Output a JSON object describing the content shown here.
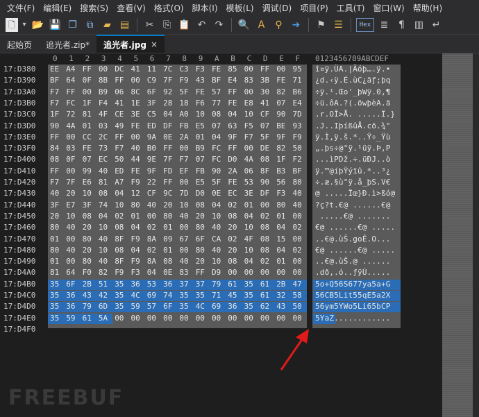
{
  "menu": [
    "文件(F)",
    "编辑(E)",
    "搜索(S)",
    "查看(V)",
    "格式(O)",
    "脚本(I)",
    "模板(L)",
    "调试(D)",
    "项目(P)",
    "工具(T)",
    "窗口(W)",
    "帮助(H)"
  ],
  "toolbar": {
    "hex_label": "Hex",
    "icons": [
      "new-file-icon",
      "dropdown-icon",
      "open-folder-icon",
      "save-icon",
      "save-all-icon",
      "copy-file-icon",
      "folder-icon",
      "folder-multi-icon",
      "cut-icon",
      "copy-icon",
      "paste-icon",
      "undo-icon",
      "redo-icon",
      "find-icon",
      "replace-icon",
      "find-replace-icon",
      "goto-arrow-icon",
      "bookmark-icon",
      "bookmark-list-icon",
      "hex-toggle-icon",
      "format-icon",
      "pilcrow-icon",
      "columns-icon",
      "wrap-icon"
    ]
  },
  "tabs": [
    {
      "label": "起始页",
      "active": false,
      "close": ""
    },
    {
      "label": "追光者.zip*",
      "active": false,
      "close": ""
    },
    {
      "label": "追光者.jpg",
      "active": true,
      "close": "×"
    }
  ],
  "hex_ruler": [
    "0",
    "1",
    "2",
    "3",
    "4",
    "5",
    "6",
    "7",
    "8",
    "9",
    "A",
    "B",
    "C",
    "D",
    "E",
    "F"
  ],
  "ascii_ruler": "0123456789ABCDEF",
  "rows": [
    {
      "addr": "17:D380",
      "bytes": [
        "EE",
        "A4",
        "FF",
        "00",
        "DC",
        "41",
        "11",
        "7C",
        "C3",
        "F3",
        "FE",
        "85",
        "00",
        "FF",
        "00",
        "95"
      ],
      "ascii": "î¤ÿ.ÜA.|Ãóþ….ÿ.•",
      "sel": 0
    },
    {
      "addr": "17:D390",
      "bytes": [
        "BF",
        "64",
        "0F",
        "8B",
        "FF",
        "00",
        "C9",
        "7F",
        "F9",
        "43",
        "BF",
        "E4",
        "83",
        "3B",
        "FE",
        "71"
      ],
      "ascii": "¿d.‹ÿ.É.ùC¿äƒ;þq",
      "sel": 0
    },
    {
      "addr": "17:D3A0",
      "bytes": [
        "F7",
        "FF",
        "00",
        "B9",
        "06",
        "8C",
        "6F",
        "92",
        "5F",
        "FE",
        "57",
        "FF",
        "00",
        "30",
        "82",
        "B6"
      ],
      "ascii": "÷ÿ.¹.Œo'_þWÿ.0‚¶",
      "sel": 0
    },
    {
      "addr": "17:D3B0",
      "bytes": [
        "F7",
        "FC",
        "1F",
        "F4",
        "41",
        "1E",
        "3F",
        "28",
        "18",
        "F6",
        "77",
        "FE",
        "E8",
        "41",
        "07",
        "E4"
      ],
      "ascii": "÷ü.ôA.?(.öwþèA.ä",
      "sel": 0
    },
    {
      "addr": "17:D3C0",
      "bytes": [
        "1F",
        "72",
        "81",
        "4F",
        "CE",
        "3E",
        "C5",
        "04",
        "A0",
        "10",
        "08",
        "04",
        "10",
        "CF",
        "90",
        "7D"
      ],
      "ascii": ".r.OÎ>Å. .....Ï.}",
      "sel": 0
    },
    {
      "addr": "17:D3D0",
      "bytes": [
        "90",
        "4A",
        "01",
        "03",
        "49",
        "FE",
        "ED",
        "DF",
        "FB",
        "E5",
        "07",
        "63",
        "F5",
        "07",
        "BE",
        "93"
      ],
      "ascii": ".J..IþíßûÅ.cõ.¾\"",
      "sel": 0
    },
    {
      "addr": "17:D3E0",
      "bytes": [
        "FF",
        "00",
        "CC",
        "2C",
        "FF",
        "00",
        "9A",
        "0E",
        "2A",
        "01",
        "04",
        "9F",
        "F7",
        "5F",
        "9F",
        "F9"
      ],
      "ascii": "ÿ.Ì,ÿ.š.*..Ÿ÷_Ÿù",
      "sel": 0
    },
    {
      "addr": "17:D3F0",
      "bytes": [
        "84",
        "03",
        "FE",
        "73",
        "F7",
        "40",
        "B0",
        "FF",
        "00",
        "B9",
        "FC",
        "FF",
        "00",
        "DE",
        "82",
        "50"
      ],
      "ascii": "„.þs÷@°ÿ.¹üÿ.Þ‚P",
      "sel": 0
    },
    {
      "addr": "17:D400",
      "bytes": [
        "08",
        "0F",
        "07",
        "EC",
        "50",
        "44",
        "9E",
        "7F",
        "F7",
        "07",
        "FC",
        "D0",
        "4A",
        "08",
        "1F",
        "F2"
      ],
      "ascii": "...ìPDž.÷.üÐJ..ò",
      "sel": 0
    },
    {
      "addr": "17:D410",
      "bytes": [
        "FF",
        "00",
        "99",
        "40",
        "ED",
        "FE",
        "9F",
        "FD",
        "EF",
        "FB",
        "90",
        "2A",
        "06",
        "8F",
        "B3",
        "BF"
      ],
      "ascii": "ÿ.™@íþŸýïû.*..³¿",
      "sel": 0
    },
    {
      "addr": "17:D420",
      "bytes": [
        "F7",
        "7F",
        "E6",
        "81",
        "A7",
        "F9",
        "22",
        "FF",
        "00",
        "E5",
        "5F",
        "FE",
        "53",
        "90",
        "56",
        "80"
      ],
      "ascii": "÷.æ.§ù\"ÿ.å_þS.V€",
      "sel": 0
    },
    {
      "addr": "17:D430",
      "bytes": [
        "40",
        "20",
        "10",
        "08",
        "04",
        "12",
        "CF",
        "9C",
        "7D",
        "D0",
        "0E",
        "EC",
        "3E",
        "DF",
        "F3",
        "40"
      ],
      "ascii": "@ .....Ïœ}Ð.ì>ßó@",
      "sel": 0
    },
    {
      "addr": "17:D440",
      "bytes": [
        "3F",
        "E7",
        "3F",
        "74",
        "10",
        "80",
        "40",
        "20",
        "10",
        "08",
        "04",
        "02",
        "01",
        "00",
        "80",
        "40"
      ],
      "ascii": "?ç?t.€@ ......€@",
      "sel": 0
    },
    {
      "addr": "17:D450",
      "bytes": [
        "20",
        "10",
        "08",
        "04",
        "02",
        "01",
        "00",
        "80",
        "40",
        "20",
        "10",
        "08",
        "04",
        "02",
        "01",
        "00"
      ],
      "ascii": " .....€@ .......",
      "sel": 0
    },
    {
      "addr": "17:D460",
      "bytes": [
        "80",
        "40",
        "20",
        "10",
        "08",
        "04",
        "02",
        "01",
        "00",
        "80",
        "40",
        "20",
        "10",
        "08",
        "04",
        "02"
      ],
      "ascii": "€@ ......€@ .....",
      "sel": 0
    },
    {
      "addr": "17:D470",
      "bytes": [
        "01",
        "00",
        "80",
        "40",
        "8F",
        "F9",
        "8A",
        "09",
        "67",
        "6F",
        "CA",
        "02",
        "4F",
        "08",
        "15",
        "00"
      ],
      "ascii": "..€@.ùŠ.goÊ.O...",
      "sel": 0
    },
    {
      "addr": "17:D480",
      "bytes": [
        "80",
        "40",
        "20",
        "10",
        "08",
        "04",
        "02",
        "01",
        "00",
        "80",
        "40",
        "20",
        "10",
        "08",
        "04",
        "02"
      ],
      "ascii": "€@ ......€@ .....",
      "sel": 0
    },
    {
      "addr": "17:D490",
      "bytes": [
        "01",
        "00",
        "80",
        "40",
        "8F",
        "F9",
        "8A",
        "08",
        "40",
        "20",
        "10",
        "08",
        "04",
        "02",
        "01",
        "00"
      ],
      "ascii": "..€@.ùŠ.@ ......",
      "sel": 0
    },
    {
      "addr": "17:D4A0",
      "bytes": [
        "81",
        "64",
        "F0",
        "82",
        "F9",
        "F3",
        "04",
        "0E",
        "83",
        "FF",
        "D9",
        "00",
        "00",
        "00",
        "00",
        "00"
      ],
      "ascii": ".dð‚.ó..ƒÿÙ.....",
      "sel": 0
    },
    {
      "addr": "17:D4B0",
      "bytes": [
        "35",
        "6F",
        "2B",
        "51",
        "35",
        "36",
        "53",
        "36",
        "37",
        "37",
        "79",
        "61",
        "35",
        "61",
        "2B",
        "47"
      ],
      "ascii": "5o+Q56S677ya5a+G",
      "sel": 16
    },
    {
      "addr": "17:D4C0",
      "bytes": [
        "35",
        "36",
        "43",
        "42",
        "35",
        "4C",
        "69",
        "74",
        "35",
        "35",
        "71",
        "45",
        "35",
        "61",
        "32",
        "58"
      ],
      "ascii": "56CB5Lit55qE5a2X",
      "sel": 16
    },
    {
      "addr": "17:D4D0",
      "bytes": [
        "35",
        "36",
        "79",
        "6D",
        "35",
        "59",
        "57",
        "6F",
        "35",
        "4C",
        "69",
        "36",
        "35",
        "62",
        "43",
        "50"
      ],
      "ascii": "56ym5YWo5Li65bCP",
      "sel": 16
    },
    {
      "addr": "17:D4E0",
      "bytes": [
        "35",
        "59",
        "61",
        "5A",
        "00",
        "00",
        "00",
        "00",
        "00",
        "00",
        "00",
        "00",
        "00",
        "00",
        "00",
        "00"
      ],
      "ascii": "5YaZ............",
      "sel": 4
    },
    {
      "addr": "17:D4F0",
      "bytes": [],
      "ascii": "",
      "sel": 0
    }
  ],
  "watermark": "FREEBUF"
}
